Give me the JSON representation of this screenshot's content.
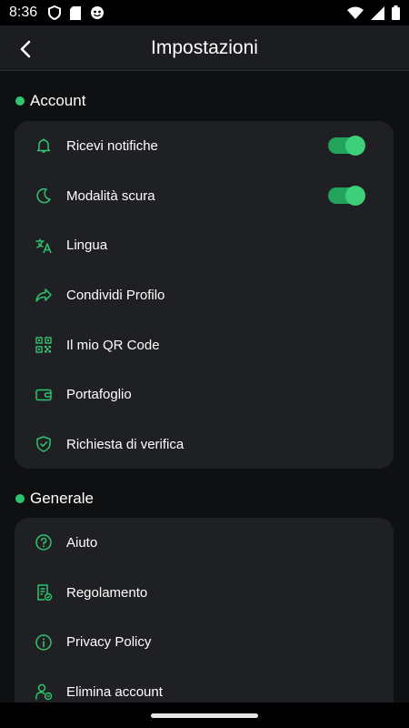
{
  "status_bar": {
    "time": "8:36"
  },
  "header": {
    "title": "Impostazioni"
  },
  "sections": [
    {
      "title": "Account",
      "items": [
        {
          "label": "Ricevi notifiche",
          "icon": "bell-icon",
          "toggle": true
        },
        {
          "label": "Modalità scura",
          "icon": "moon-icon",
          "toggle": true
        },
        {
          "label": "Lingua",
          "icon": "translate-icon"
        },
        {
          "label": "Condividi Profilo",
          "icon": "share-icon"
        },
        {
          "label": "Il mio QR Code",
          "icon": "qr-code-icon"
        },
        {
          "label": "Portafoglio",
          "icon": "wallet-icon"
        },
        {
          "label": "Richiesta di verifica",
          "icon": "shield-check-icon"
        }
      ]
    },
    {
      "title": "Generale",
      "items": [
        {
          "label": "Aiuto",
          "icon": "help-icon"
        },
        {
          "label": "Regolamento",
          "icon": "rules-document-icon"
        },
        {
          "label": "Privacy Policy",
          "icon": "info-icon"
        },
        {
          "label": "Elimina account",
          "icon": "delete-user-icon"
        }
      ]
    }
  ],
  "colors": {
    "accent": "#2fc46e",
    "card": "#1f2023",
    "background": "#0f1012"
  }
}
